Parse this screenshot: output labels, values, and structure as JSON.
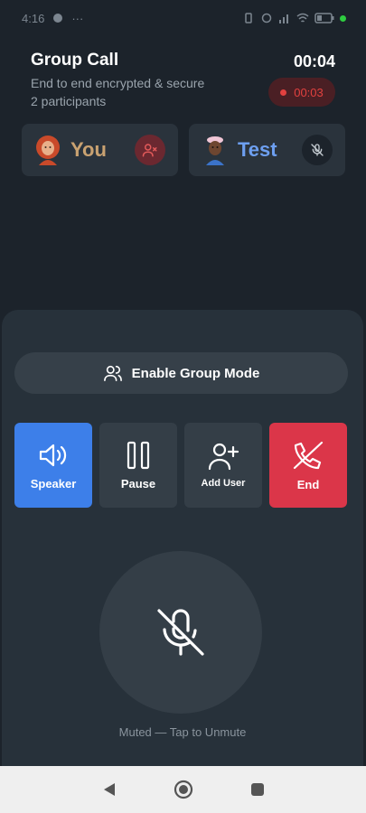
{
  "status_bar": {
    "time": "4:16",
    "extra": "···"
  },
  "header": {
    "title": "Group Call",
    "subtitle": "End to end encrypted & secure",
    "participants": "2 participants",
    "timer": "00:04",
    "recording_time": "00:03"
  },
  "participants": [
    {
      "name": "You",
      "mic_state": "muted-red"
    },
    {
      "name": "Test",
      "mic_state": "muted"
    }
  ],
  "controls": {
    "group_mode_label": "Enable Group Mode",
    "speaker_label": "Speaker",
    "pause_label": "Pause",
    "add_user_label": "Add User",
    "end_label": "End"
  },
  "mute": {
    "label": "Muted — Tap to Unmute"
  },
  "colors": {
    "background": "#1c232b",
    "panel": "#27313a",
    "speaker_active": "#3d7fe9",
    "end": "#db3649",
    "record": "#e2413f",
    "you_name": "#c9a271",
    "test_name": "#6d9ff0"
  },
  "icons": {
    "group": "users-icon",
    "speaker": "speaker-icon",
    "pause": "pause-icon",
    "add_user": "user-plus-icon",
    "end": "phone-off-icon",
    "mute": "mic-off-icon"
  }
}
